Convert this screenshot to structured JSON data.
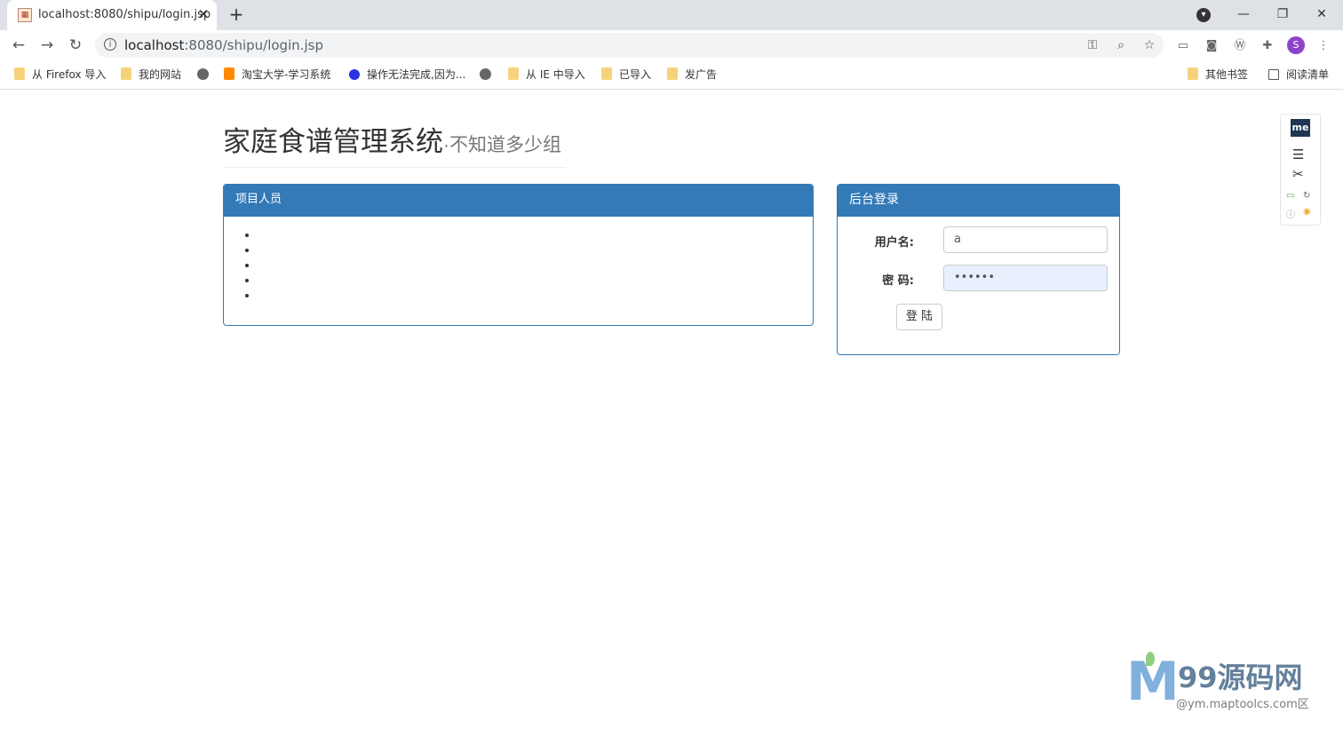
{
  "browser": {
    "tab_title": "localhost:8080/shipu/login.jsp",
    "tab_close": "✕",
    "new_tab": "+",
    "url_host": "localhost",
    "url_rest": ":8080/shipu/login.jsp",
    "avatar_letter": "S",
    "bookmarks": [
      {
        "label": "从 Firefox 导入",
        "icon": "folder-icon"
      },
      {
        "label": "我的网站",
        "icon": "folder-icon"
      },
      {
        "label": "",
        "icon": "globe-icon"
      },
      {
        "label": "淘宝大学-学习系统",
        "icon": "taobao-icon"
      },
      {
        "label": "操作无法完成,因为...",
        "icon": "baidu-icon"
      },
      {
        "label": "",
        "icon": "globe-icon"
      },
      {
        "label": "从 IE 中导入",
        "icon": "folder-icon"
      },
      {
        "label": "已导入",
        "icon": "folder-icon"
      },
      {
        "label": "发广告",
        "icon": "folder-icon"
      },
      {
        "label": "其他书签",
        "icon": "folder-icon"
      },
      {
        "label": "阅读清单",
        "icon": "reading-list-icon"
      }
    ]
  },
  "page": {
    "title_main": "家庭食谱管理系统",
    "title_sub": "·不知道多少组"
  },
  "members_panel": {
    "heading": "项目人员",
    "items": [
      "",
      "",
      "",
      "",
      ""
    ]
  },
  "login_panel": {
    "heading": "后台登录",
    "username_label": "用户名:",
    "username_value": "a",
    "password_label": "密 码:",
    "password_value": "••••••",
    "submit_label": "登 陆"
  },
  "extension": {
    "badge": "me"
  },
  "watermark": {
    "brand": "99源码网",
    "site": "@ym.maptoolcs.com区"
  }
}
